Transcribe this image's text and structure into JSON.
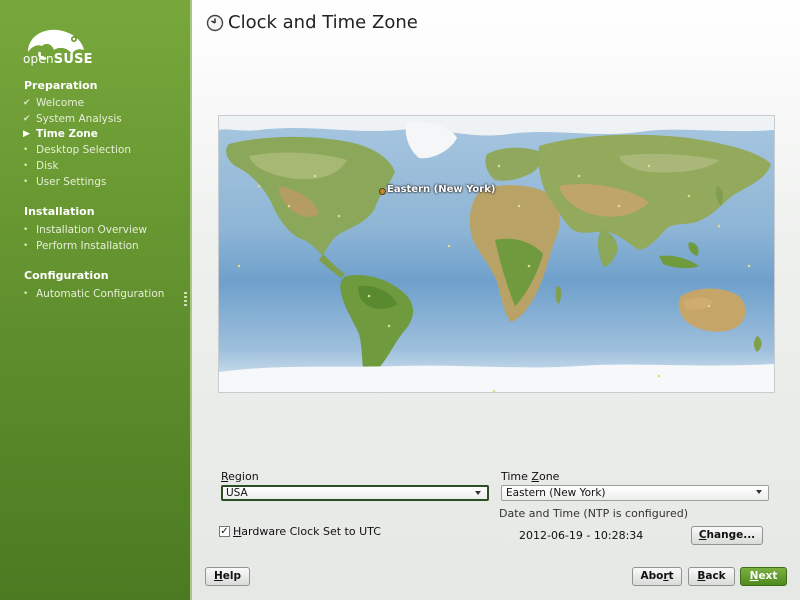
{
  "brand": {
    "name_light": "open",
    "name_bold": "SUSE"
  },
  "sidebar": {
    "sections": [
      {
        "title": "Preparation",
        "steps": [
          {
            "label": "Welcome",
            "state": "done"
          },
          {
            "label": "System Analysis",
            "state": "done"
          },
          {
            "label": "Time Zone",
            "state": "current"
          },
          {
            "label": "Desktop Selection",
            "state": "pending"
          },
          {
            "label": "Disk",
            "state": "pending"
          },
          {
            "label": "User Settings",
            "state": "pending"
          }
        ]
      },
      {
        "title": "Installation",
        "steps": [
          {
            "label": "Installation Overview",
            "state": "pending"
          },
          {
            "label": "Perform Installation",
            "state": "pending"
          }
        ]
      },
      {
        "title": "Configuration",
        "steps": [
          {
            "label": "Automatic Configuration",
            "state": "pending"
          }
        ]
      }
    ]
  },
  "page": {
    "title": "Clock and Time Zone",
    "title_icon": "clock-icon"
  },
  "map": {
    "selected_label": "Eastern (New York)"
  },
  "form": {
    "region_label": "Region",
    "region_value": "USA",
    "timezone_label": "Time Zone",
    "timezone_value": "Eastern (New York)",
    "hwclock_label": "Hardware Clock Set to UTC",
    "hwclock_checked": true,
    "datetime_label": "Date and Time (NTP is configured)",
    "datetime_value": "2012-06-19 - 10:28:34",
    "change_label": "Change..."
  },
  "buttons": {
    "help": "Help",
    "abort": "Abort",
    "back": "Back",
    "next": "Next"
  },
  "colors": {
    "sidebar": "#6b9a33",
    "primary": "#5f9a2a"
  }
}
